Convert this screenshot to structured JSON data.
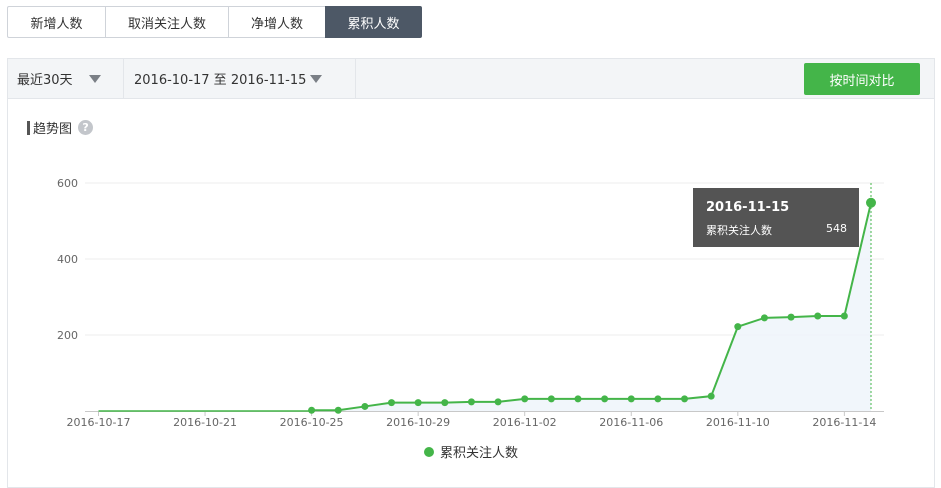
{
  "tabs": [
    {
      "label": "新增人数",
      "active": false
    },
    {
      "label": "取消关注人数",
      "active": false
    },
    {
      "label": "净增人数",
      "active": false
    },
    {
      "label": "累积人数",
      "active": true
    }
  ],
  "filter": {
    "period": "最近30天",
    "date_range": "2016-10-17 至 2016-11-15",
    "compare_button": "按时间对比"
  },
  "section": {
    "title": "趋势图",
    "help_icon": "question-mark-icon",
    "help_glyph": "?"
  },
  "colors": {
    "line": "#44b549",
    "active_tab": "#4d5866",
    "button": "#44b549"
  },
  "tooltip": {
    "date": "2016-11-15",
    "label": "累积关注人数",
    "value": "548"
  },
  "legend": {
    "label": "累积关注人数"
  },
  "chart_data": {
    "type": "line",
    "area": true,
    "grid": "horizontal",
    "legend_position": "bottom",
    "ylim": [
      0,
      600
    ],
    "yticks": [
      200,
      400,
      600
    ],
    "xticks": [
      "2016-10-17",
      "2016-10-21",
      "2016-10-25",
      "2016-10-29",
      "2016-11-02",
      "2016-11-06",
      "2016-11-10",
      "2016-11-14"
    ],
    "x": [
      "2016-10-25",
      "2016-10-26",
      "2016-10-27",
      "2016-10-28",
      "2016-10-29",
      "2016-10-30",
      "2016-10-31",
      "2016-11-01",
      "2016-11-02",
      "2016-11-03",
      "2016-11-04",
      "2016-11-05",
      "2016-11-06",
      "2016-11-07",
      "2016-11-08",
      "2016-11-09",
      "2016-11-10",
      "2016-11-11",
      "2016-11-12",
      "2016-11-13",
      "2016-11-14",
      "2016-11-15"
    ],
    "series": [
      {
        "name": "累积关注人数",
        "values": [
          2,
          2,
          12,
          22,
          22,
          22,
          24,
          24,
          32,
          32,
          32,
          32,
          32,
          32,
          32,
          39,
          222,
          245,
          247,
          250,
          250,
          548
        ]
      }
    ]
  }
}
